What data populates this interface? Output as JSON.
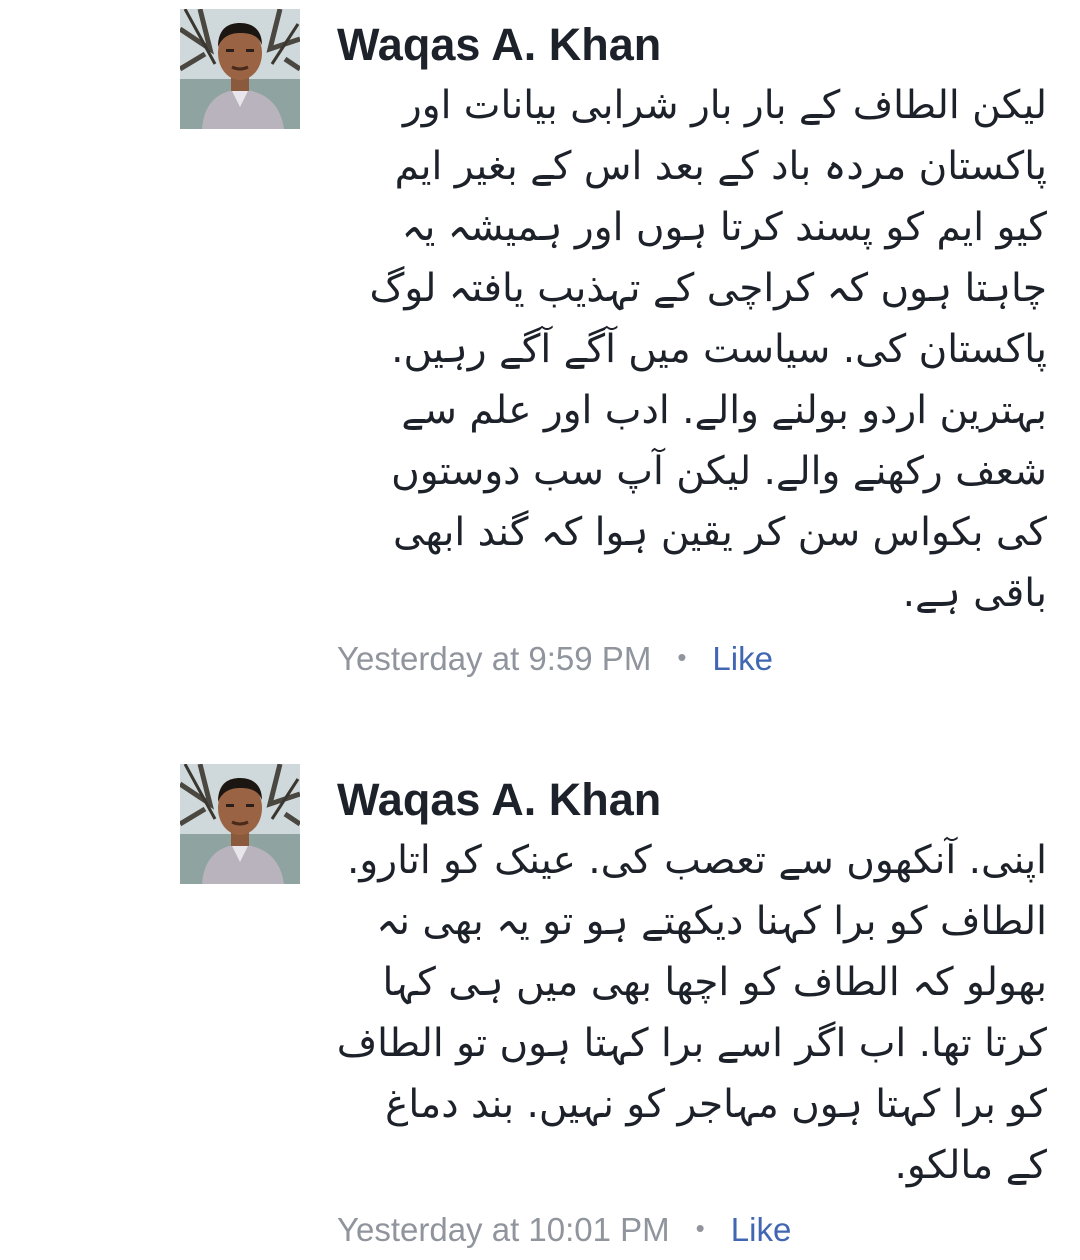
{
  "comments": [
    {
      "author": "Waqas A. Khan",
      "text": "لیکن الطاف کے بار بار شرابی بیانات اور پاکستان مردہ باد کے بعد اس کے بغیر ایم کیو ایم کو پسند کرتا ہوں اور ہمیشہ یہ چاہتا ہوں کہ کراچی کے تہذیب یافتہ لوگ پاکستان کی. سیاست میں آگے آگے رہیں. بہترین اردو بولنے والے. ادب اور علم سے شعف رکھنے والے. لیکن آپ سب دوستوں کی بکواس سن کر یقین ہوا کہ گند ابھی باقی ہے.",
      "timestamp": "Yesterday at 9:59 PM",
      "separator": "•",
      "like_label": "Like"
    },
    {
      "author": "Waqas A. Khan",
      "text": "اپنی. آنکھوں سے تعصب کی. عینک کو اتارو. الطاف کو برا کہنا دیکھتے ہو تو یہ بھی نہ بھولو کہ الطاف کو اچھا بھی میں ہی کہا کرتا تھا. اب اگر اسے برا کہتا ہوں تو الطاف کو برا کہتا ہوں مہاجر کو نہیں. بند دماغ کے مالکو.",
      "timestamp": "Yesterday at 10:01 PM",
      "separator": "•",
      "like_label": "Like"
    }
  ]
}
